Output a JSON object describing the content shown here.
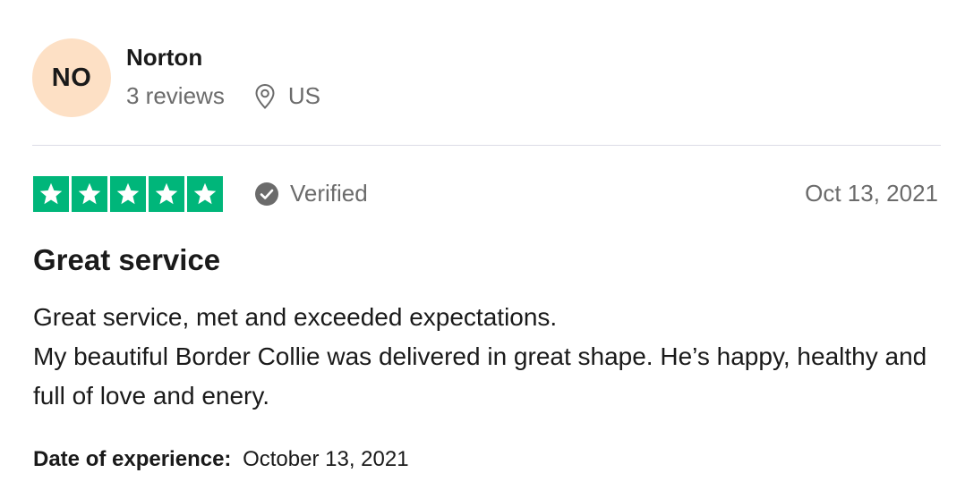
{
  "reviewer": {
    "initials": "NO",
    "name": "Norton",
    "reviews_count": "3 reviews",
    "location": "US",
    "avatar_color": "#fde0c5",
    "location_icon": "location-pin-icon"
  },
  "rating": {
    "stars": 5,
    "max_stars": 5,
    "star_color": "#00b67a",
    "verified_label": "Verified",
    "verified_icon": "check-circle-icon",
    "date": "Oct 13, 2021"
  },
  "review": {
    "title": "Great service",
    "body_lines": [
      "Great service, met and exceeded expectations.",
      "My beautiful Border Collie was delivered in great shape. He’s happy, healthy and full of love and enery."
    ],
    "experience_label": "Date of experience:",
    "experience_date": "October 13, 2021"
  }
}
